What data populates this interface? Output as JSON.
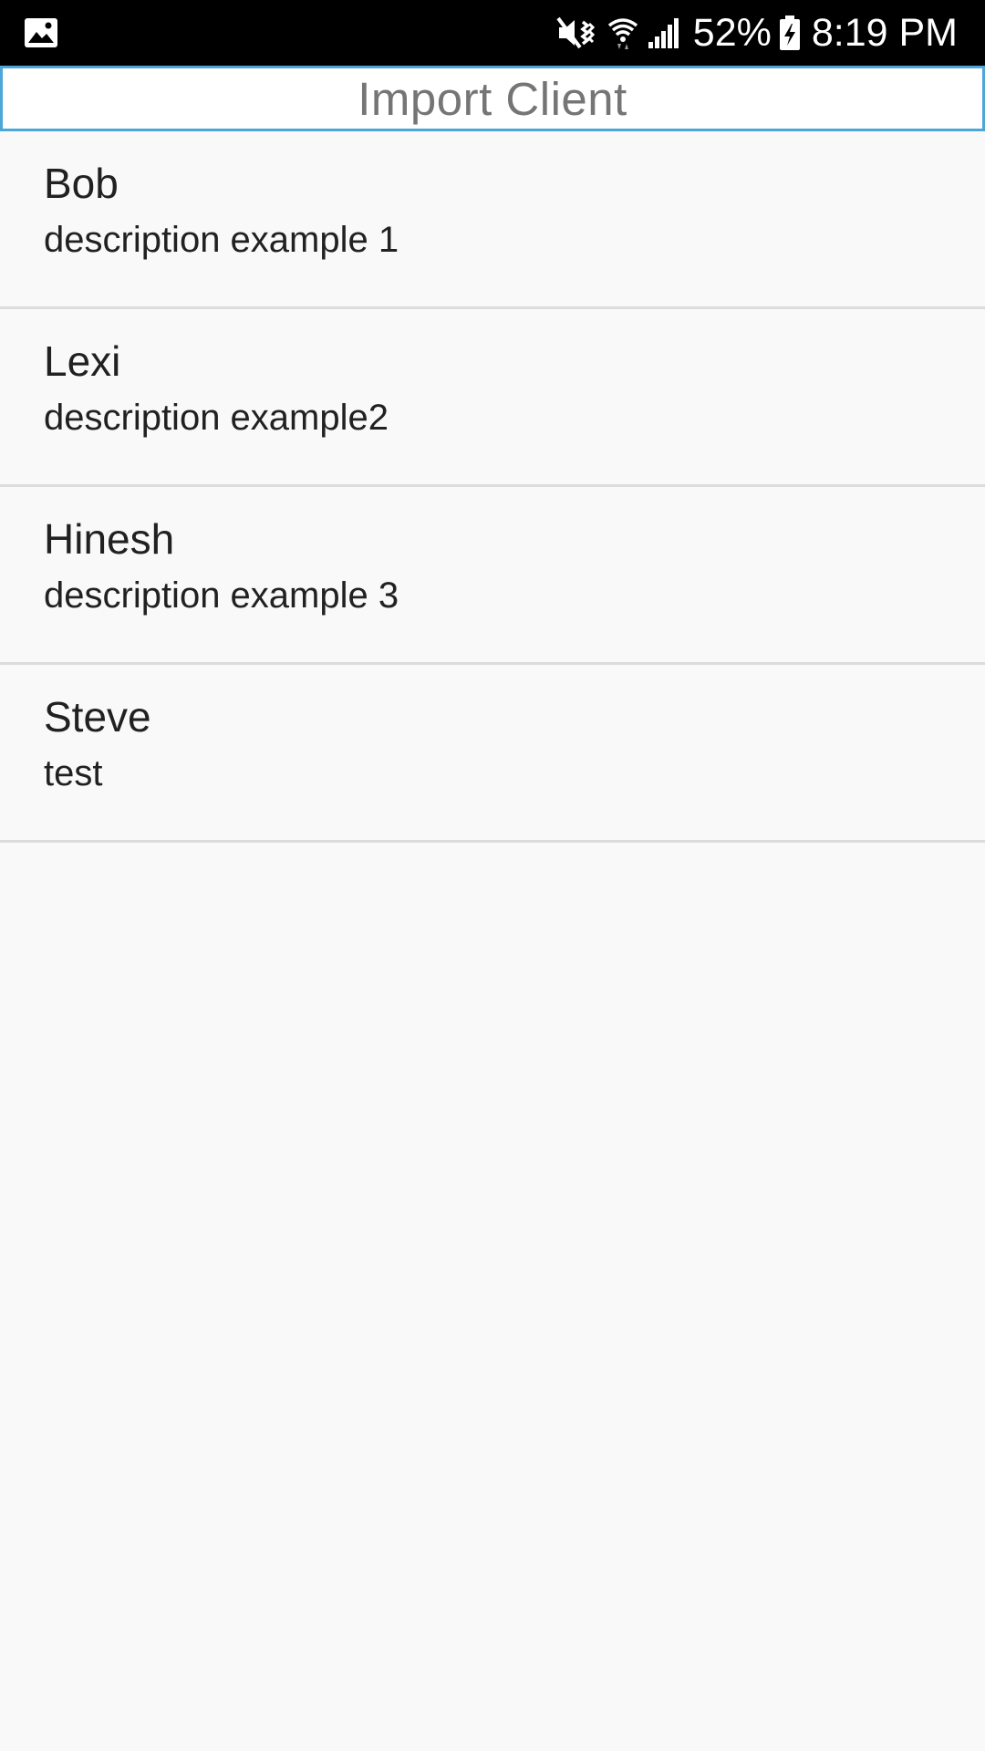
{
  "status_bar": {
    "left_icon": "image-notification-icon",
    "icons": [
      "mute-vibrate-icon",
      "wifi-icon",
      "signal-icon"
    ],
    "battery_percent": "52%",
    "battery_icon": "battery-charging-icon",
    "time": "8:19 PM"
  },
  "header": {
    "title": "Import Client"
  },
  "clients": [
    {
      "name": "Bob",
      "description": "description example 1"
    },
    {
      "name": "Lexi",
      "description": "description example2"
    },
    {
      "name": "Hinesh",
      "description": "description example 3"
    },
    {
      "name": "Steve",
      "description": "test"
    }
  ],
  "colors": {
    "status_bar_bg": "#000000",
    "header_border": "#4da6d8",
    "header_title": "#757575",
    "background": "#f9f9f9",
    "divider": "#dcdcdc",
    "text_primary": "#212121"
  }
}
